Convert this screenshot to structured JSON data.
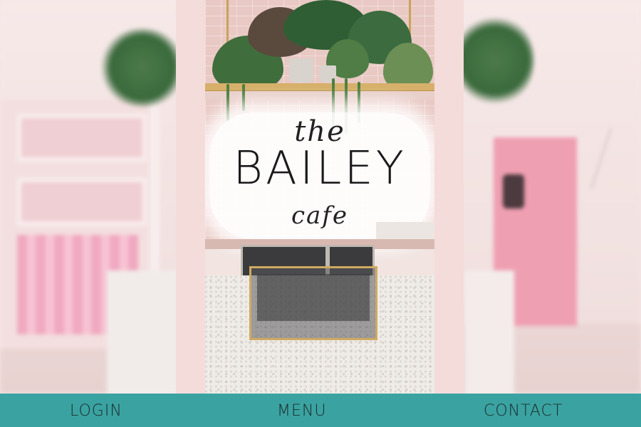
{
  "brand": {
    "logo_the": "the",
    "logo_main": "BAILEY",
    "logo_cafe": "cafe"
  },
  "nav": {
    "items": [
      {
        "label": "LOGIN"
      },
      {
        "label": "MENU"
      },
      {
        "label": "CONTACT"
      }
    ]
  },
  "colors": {
    "nav_bar": "#3aa3a1",
    "card_frame": "#f3dcd9",
    "nav_text": "#1b2b2b"
  }
}
